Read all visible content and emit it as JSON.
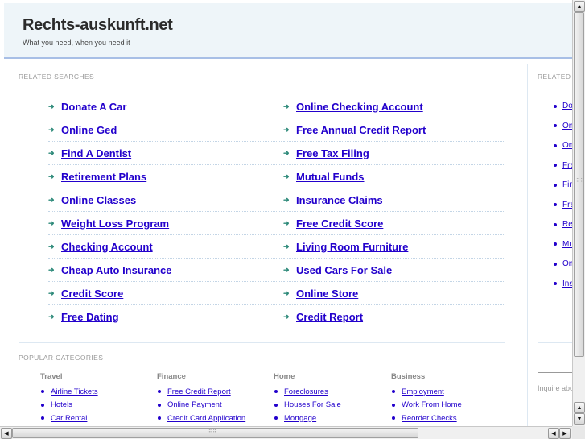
{
  "header": {
    "title": "Rechts-auskunft.net",
    "tagline": "What you need, when you need it"
  },
  "related_searches": {
    "label": "RELATED SEARCHES",
    "arrow_icon": "➜",
    "left": [
      "Donate A Car",
      "Online Ged",
      "Find A Dentist",
      "Retirement Plans",
      "Online Classes",
      "Weight Loss Program",
      "Checking Account",
      "Cheap Auto Insurance",
      "Credit Score",
      "Free Dating"
    ],
    "right": [
      "Online Checking Account",
      "Free Annual Credit Report",
      "Free Tax Filing",
      "Mutual Funds",
      "Insurance Claims",
      "Free Credit Score",
      "Living Room Furniture",
      "Used Cars For Sale",
      "Online Store",
      "Credit Report"
    ]
  },
  "popular_categories": {
    "label": "POPULAR CATEGORIES",
    "columns": [
      {
        "heading": "Travel",
        "items": [
          "Airline Tickets",
          "Hotels",
          "Car Rental"
        ]
      },
      {
        "heading": "Finance",
        "items": [
          "Free Credit Report",
          "Online Payment",
          "Credit Card Application"
        ]
      },
      {
        "heading": "Home",
        "items": [
          "Foreclosures",
          "Houses For Sale",
          "Mortgage"
        ]
      },
      {
        "heading": "Business",
        "items": [
          "Employment",
          "Work From Home",
          "Reorder Checks"
        ]
      }
    ]
  },
  "sidebar": {
    "label": "RELATED",
    "items": [
      "Do",
      "On",
      "On",
      "Fre",
      "Fin",
      "Fre",
      "Re",
      "Mu",
      "On",
      "Ins"
    ],
    "search_value": "",
    "inquire_text": "Inquire abo"
  },
  "scrollbars": {
    "up": "▲",
    "down": "▼",
    "left": "◀",
    "right": "▶",
    "grip": "⠿⠿"
  }
}
